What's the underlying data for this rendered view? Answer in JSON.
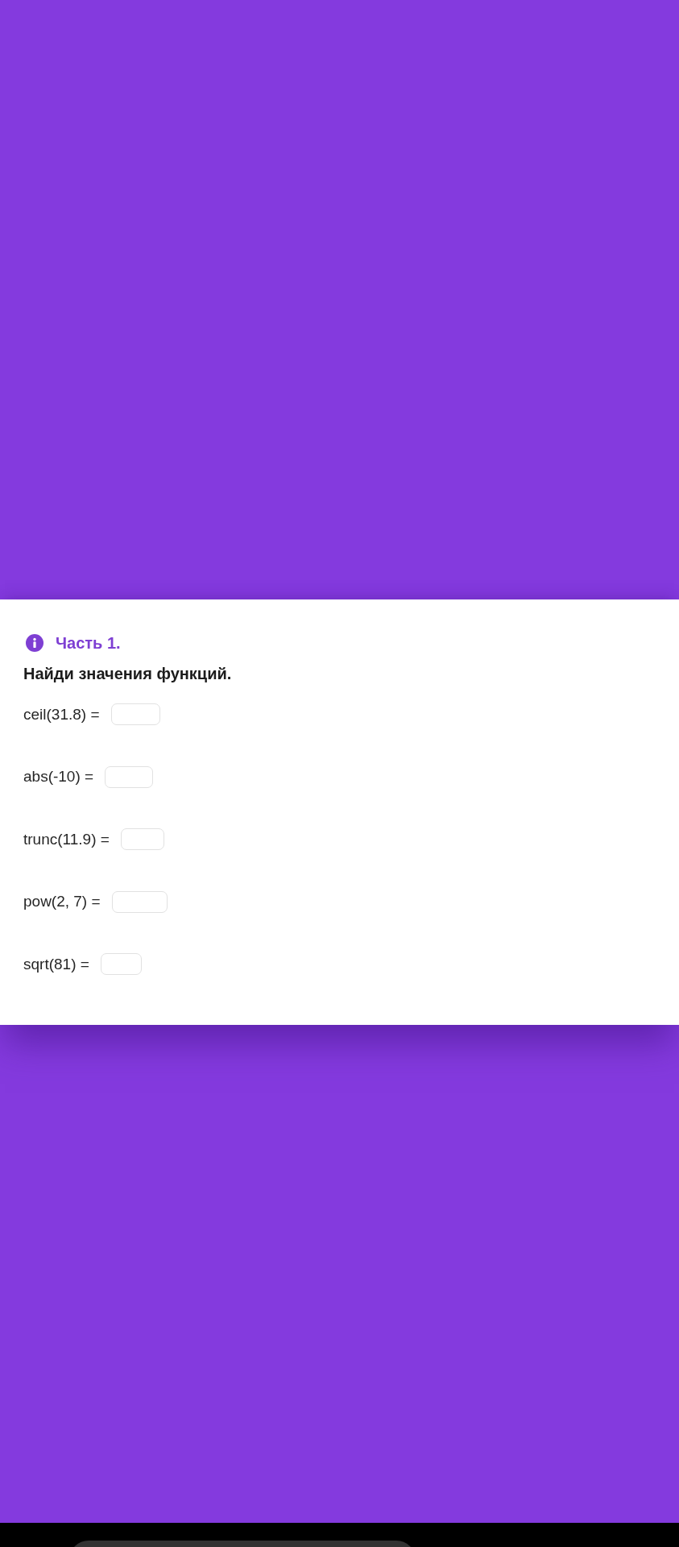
{
  "part": {
    "title": "Часть 1."
  },
  "instruction": "Найди значения функций.",
  "exercises": [
    {
      "expression": "ceil(31.8) ="
    },
    {
      "expression": "abs(-10) ="
    },
    {
      "expression": "trunc(11.9) ="
    },
    {
      "expression": "pow(2, 7) ="
    },
    {
      "expression": "sqrt(81) ="
    }
  ]
}
